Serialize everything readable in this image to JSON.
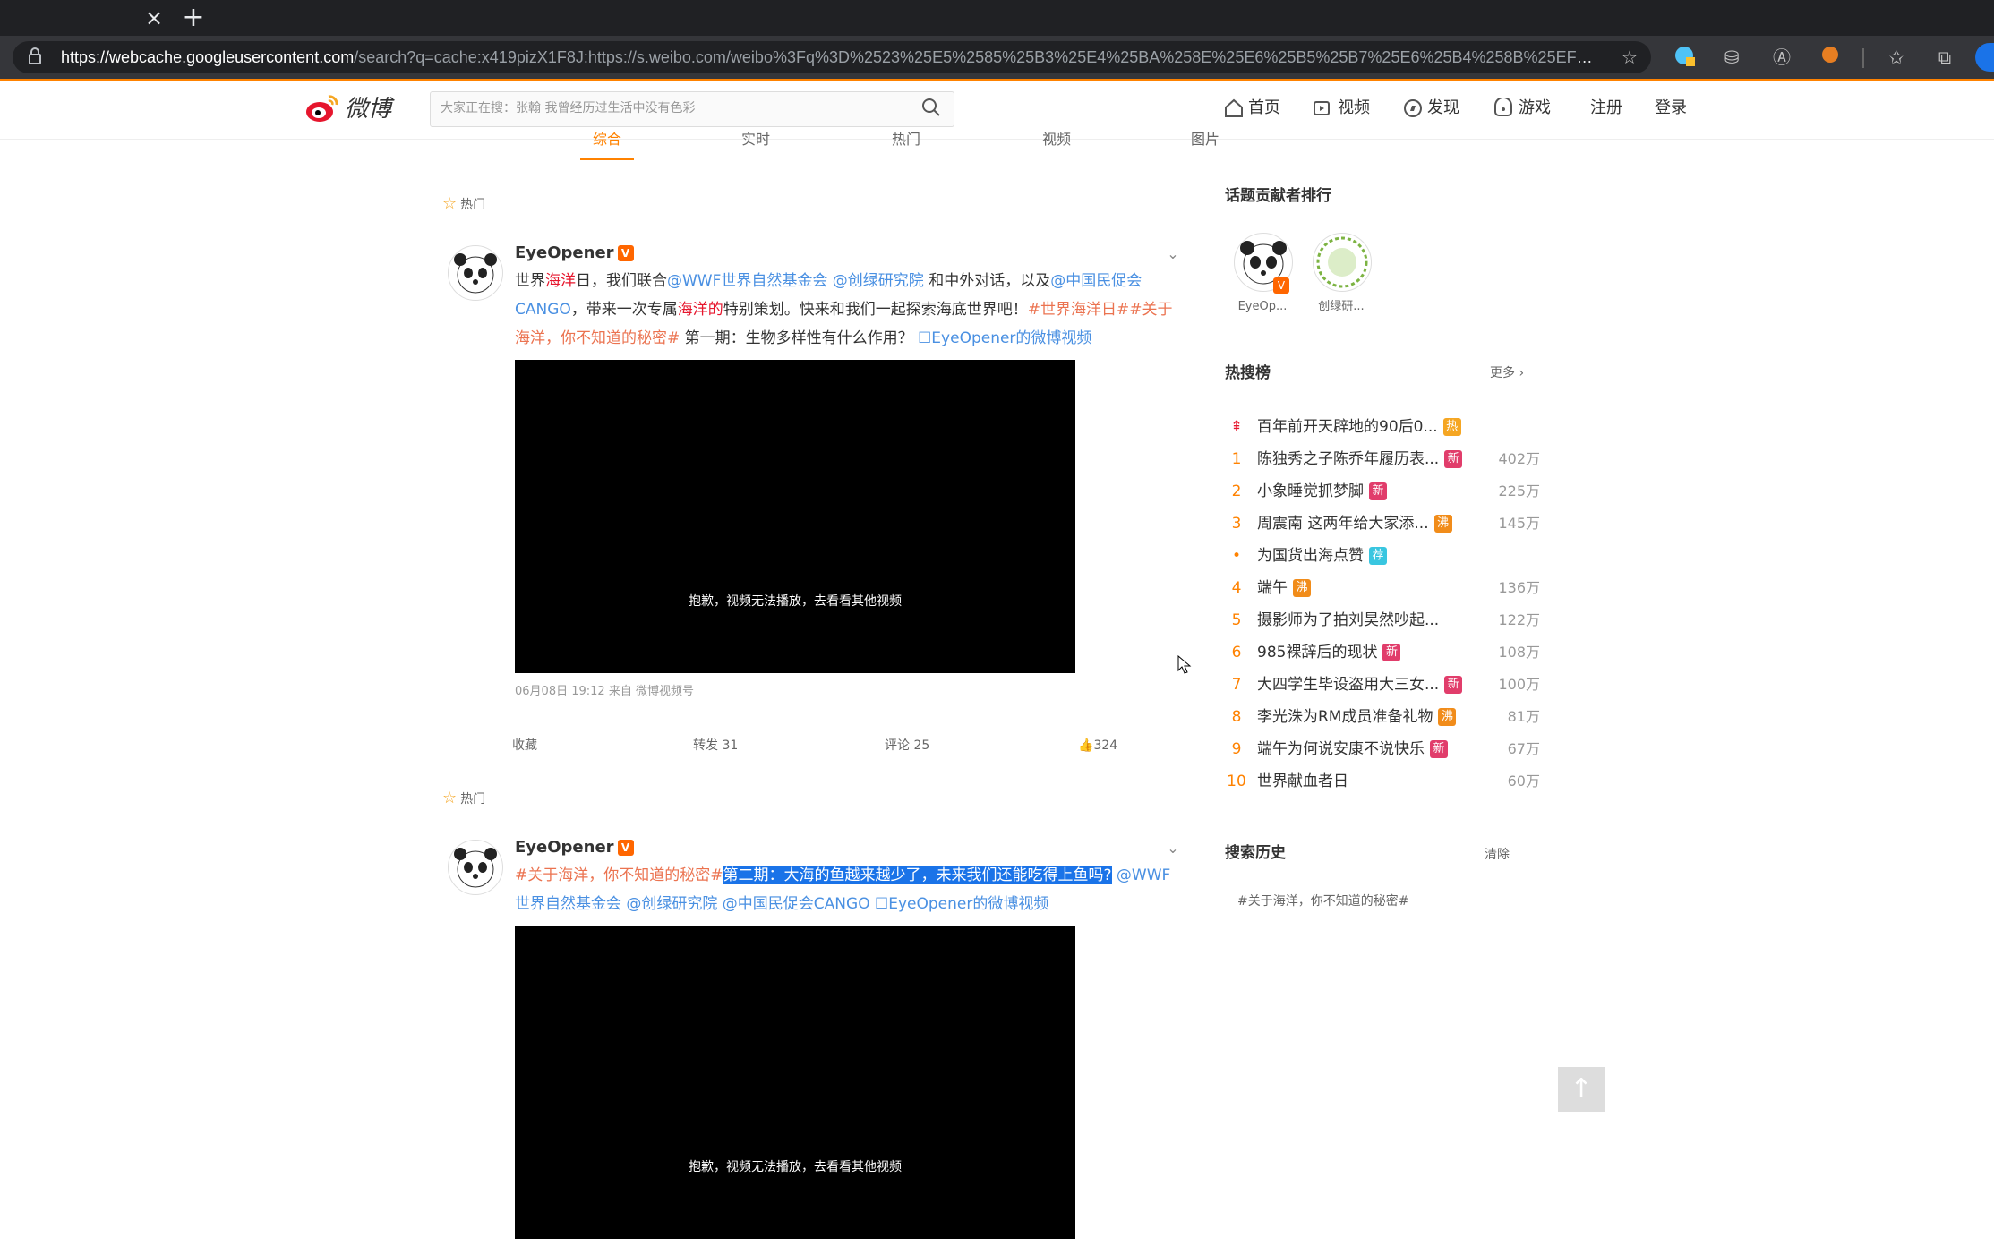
{
  "browser": {
    "url_host": "https://webcache.googleusercontent.com",
    "url_rest": "/search?q=cache:x419pizX1F8J:https://s.weibo.com/weibo%3Fq%3D%2523%25E5%2585%25B3%25E4%25BA%258E%25E6%25B5%25B7%25E6%25B4%258B%25EF%25BC%258C%2..."
  },
  "header": {
    "logo_text": "微博",
    "search_placeholder": "大家正在搜：张翰 我曾经历过生活中没有色彩",
    "nav": [
      {
        "label": "首页",
        "icon": "home-icon"
      },
      {
        "label": "视频",
        "icon": "video-icon"
      },
      {
        "label": "发现",
        "icon": "compass-icon"
      },
      {
        "label": "游戏",
        "icon": "game-icon"
      }
    ],
    "register": "注册",
    "login": "登录"
  },
  "tabs": [
    "综合",
    "实时",
    "热门",
    "视频",
    "图片"
  ],
  "posts": [
    {
      "hot_label": "热门",
      "user": "EyeOpener",
      "text_parts": [
        {
          "t": "世界",
          "c": ""
        },
        {
          "t": "海洋",
          "c": "red"
        },
        {
          "t": "日，我们联合",
          "c": ""
        },
        {
          "t": "@WWF世界自然基金会 @创绿研究院",
          "c": "link"
        },
        {
          "t": " 和中外对话，以及",
          "c": ""
        },
        {
          "t": "@中国民促会CANGO",
          "c": "link"
        },
        {
          "t": "，带来一次专属",
          "c": ""
        },
        {
          "t": "海洋的",
          "c": "red"
        },
        {
          "t": "特别策划。快来和我们一起探索海底世界吧！",
          "c": ""
        },
        {
          "t": "#世界海洋日##关于海洋，你不知道的秘密#",
          "c": "tag"
        },
        {
          "t": " 第一期：生物多样性有什么作用？ ",
          "c": ""
        },
        {
          "t": "☐EyeOpener的微博视频",
          "c": "link"
        }
      ],
      "video_message": "抱歉，视频无法播放，去看看其他视频",
      "meta": "06月08日 19:12  来自 微博视频号",
      "actions": {
        "fav": "收藏",
        "repost": "转发 31",
        "comment": "评论 25",
        "like": "324"
      }
    },
    {
      "hot_label": "热门",
      "user": "EyeOpener",
      "text_parts": [
        {
          "t": "#关于海洋，你不知道的秘密#",
          "c": "tag"
        },
        {
          "t": "第二期：大海的鱼越来越少了，未来我们还能吃得上鱼吗?",
          "c": "hl"
        },
        {
          "t": " @WWF世界自然基金会 @创绿研究院 @中国民促会CANGO ☐EyeOpener的微博视频",
          "c": "link"
        }
      ],
      "video_message": "抱歉，视频无法播放，去看看其他视频"
    }
  ],
  "sidebar": {
    "contrib_title": "话题贡献者排行",
    "contributors": [
      {
        "name": "EyeOp..."
      },
      {
        "name": "创绿研..."
      }
    ],
    "hot_title": "热搜榜",
    "more": "更多",
    "hot_list": [
      {
        "rank": "top",
        "text": "百年前开天辟地的90后0...",
        "badge": "热",
        "badge_color": "#f5a623",
        "num": ""
      },
      {
        "rank": "1",
        "text": "陈独秀之子陈乔年履历表...",
        "badge": "新",
        "badge_color": "#e13d6b",
        "num": "402万"
      },
      {
        "rank": "2",
        "text": "小象睡觉抓梦脚",
        "badge": "新",
        "badge_color": "#e13d6b",
        "num": "225万"
      },
      {
        "rank": "3",
        "text": "周震南 这两年给大家添...",
        "badge": "沸",
        "badge_color": "#f18c1a",
        "num": "145万"
      },
      {
        "rank": "•",
        "text": "为国货出海点赞",
        "badge": "荐",
        "badge_color": "#39c6e0",
        "num": ""
      },
      {
        "rank": "4",
        "text": "端午",
        "badge": "沸",
        "badge_color": "#f18c1a",
        "num": "136万"
      },
      {
        "rank": "5",
        "text": "摄影师为了拍刘昊然吵起...",
        "badge": "",
        "badge_color": "",
        "num": "122万"
      },
      {
        "rank": "6",
        "text": "985裸辞后的现状",
        "badge": "新",
        "badge_color": "#e13d6b",
        "num": "108万"
      },
      {
        "rank": "7",
        "text": "大四学生毕设盗用大三女...",
        "badge": "新",
        "badge_color": "#e13d6b",
        "num": "100万"
      },
      {
        "rank": "8",
        "text": "李光洙为RM成员准备礼物",
        "badge": "沸",
        "badge_color": "#f18c1a",
        "num": "81万"
      },
      {
        "rank": "9",
        "text": "端午为何说安康不说快乐",
        "badge": "新",
        "badge_color": "#e13d6b",
        "num": "67万"
      },
      {
        "rank": "10",
        "text": "世界献血者日",
        "badge": "",
        "badge_color": "",
        "num": "60万"
      }
    ],
    "history_title": "搜索历史",
    "history_clear": "清除",
    "history_items": [
      "#关于海洋，你不知道的秘密#"
    ]
  }
}
